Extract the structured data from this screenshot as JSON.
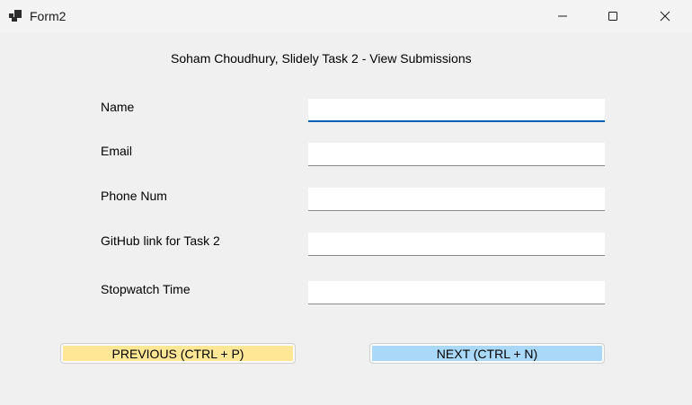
{
  "window": {
    "title": "Form2",
    "icons": {
      "app": "form-app-icon",
      "minimize": "minimize-icon",
      "maximize": "maximize-icon",
      "close": "close-icon"
    }
  },
  "form": {
    "heading": "Soham Choudhury, Slidely Task 2 - View Submissions",
    "fields": [
      {
        "label": "Name",
        "value": ""
      },
      {
        "label": "Email",
        "value": ""
      },
      {
        "label": "Phone Num",
        "value": ""
      },
      {
        "label": "GitHub link for Task 2",
        "value": ""
      },
      {
        "label": "Stopwatch Time",
        "value": ""
      }
    ]
  },
  "buttons": {
    "previous": "PREVIOUS (CTRL + P)",
    "next": "NEXT (CTRL + N)"
  },
  "colors": {
    "previous_button": "#ffe795",
    "next_button": "#a9d8f8",
    "focus_accent": "#005fb8"
  }
}
